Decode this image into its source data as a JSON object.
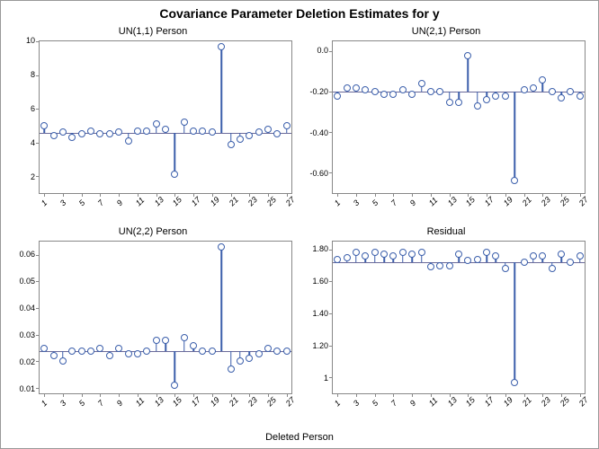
{
  "title": "Covariance Parameter Deletion Estimates for y",
  "xlabel": "Deleted Person",
  "xticks": [
    1,
    3,
    5,
    7,
    9,
    11,
    13,
    15,
    17,
    19,
    21,
    23,
    25,
    27
  ],
  "chart_data": [
    {
      "type": "needle",
      "title": "UN(1,1) Person",
      "x": [
        1,
        2,
        3,
        4,
        5,
        6,
        7,
        8,
        9,
        10,
        11,
        12,
        13,
        14,
        15,
        16,
        17,
        18,
        19,
        20,
        21,
        22,
        23,
        24,
        25,
        26,
        27
      ],
      "values": [
        5.0,
        4.4,
        4.6,
        4.3,
        4.5,
        4.7,
        4.5,
        4.5,
        4.6,
        4.1,
        4.7,
        4.7,
        5.1,
        4.8,
        2.1,
        5.2,
        4.7,
        4.7,
        4.6,
        9.7,
        3.9,
        4.2,
        4.4,
        4.6,
        4.8,
        4.5,
        5.0
      ],
      "ref": 4.56,
      "ylim": [
        1,
        10
      ],
      "yticks": [
        2,
        4,
        6,
        8,
        10
      ]
    },
    {
      "type": "needle",
      "title": "UN(2,1) Person",
      "x": [
        1,
        2,
        3,
        4,
        5,
        6,
        7,
        8,
        9,
        10,
        11,
        12,
        13,
        14,
        15,
        16,
        17,
        18,
        19,
        20,
        21,
        22,
        23,
        24,
        25,
        26,
        27
      ],
      "values": [
        -0.22,
        -0.18,
        -0.18,
        -0.19,
        -0.2,
        -0.21,
        -0.21,
        -0.19,
        -0.21,
        -0.16,
        -0.2,
        -0.2,
        -0.25,
        -0.25,
        -0.02,
        -0.27,
        -0.24,
        -0.22,
        -0.22,
        -0.64,
        -0.19,
        -0.18,
        -0.14,
        -0.2,
        -0.23,
        -0.2,
        -0.22
      ],
      "ref": -0.2,
      "ylim": [
        -0.7,
        0.05
      ],
      "yticks": [
        -0.6,
        -0.4,
        -0.2,
        0.0
      ]
    },
    {
      "type": "needle",
      "title": "UN(2,2) Person",
      "x": [
        1,
        2,
        3,
        4,
        5,
        6,
        7,
        8,
        9,
        10,
        11,
        12,
        13,
        14,
        15,
        16,
        17,
        18,
        19,
        20,
        21,
        22,
        23,
        24,
        25,
        26,
        27
      ],
      "values": [
        0.025,
        0.022,
        0.02,
        0.024,
        0.024,
        0.024,
        0.025,
        0.022,
        0.025,
        0.023,
        0.023,
        0.024,
        0.028,
        0.028,
        0.011,
        0.029,
        0.026,
        0.024,
        0.024,
        0.063,
        0.017,
        0.02,
        0.021,
        0.023,
        0.025,
        0.024,
        0.024
      ],
      "ref": 0.024,
      "ylim": [
        0.008,
        0.065
      ],
      "yticks": [
        0.01,
        0.02,
        0.03,
        0.04,
        0.05,
        0.06
      ]
    },
    {
      "type": "needle",
      "title": "Residual",
      "x": [
        1,
        2,
        3,
        4,
        5,
        6,
        7,
        8,
        9,
        10,
        11,
        12,
        13,
        14,
        15,
        16,
        17,
        18,
        19,
        20,
        21,
        22,
        23,
        24,
        25,
        26,
        27
      ],
      "values": [
        1.74,
        1.75,
        1.78,
        1.76,
        1.78,
        1.77,
        1.76,
        1.78,
        1.77,
        1.78,
        1.69,
        1.7,
        1.7,
        1.77,
        1.73,
        1.74,
        1.78,
        1.76,
        1.68,
        0.97,
        1.72,
        1.76,
        1.76,
        1.68,
        1.77,
        1.72,
        1.76
      ],
      "ref": 1.72,
      "ylim": [
        0.9,
        1.85
      ],
      "yticks": [
        1.0,
        1.2,
        1.4,
        1.6,
        1.8
      ]
    }
  ]
}
